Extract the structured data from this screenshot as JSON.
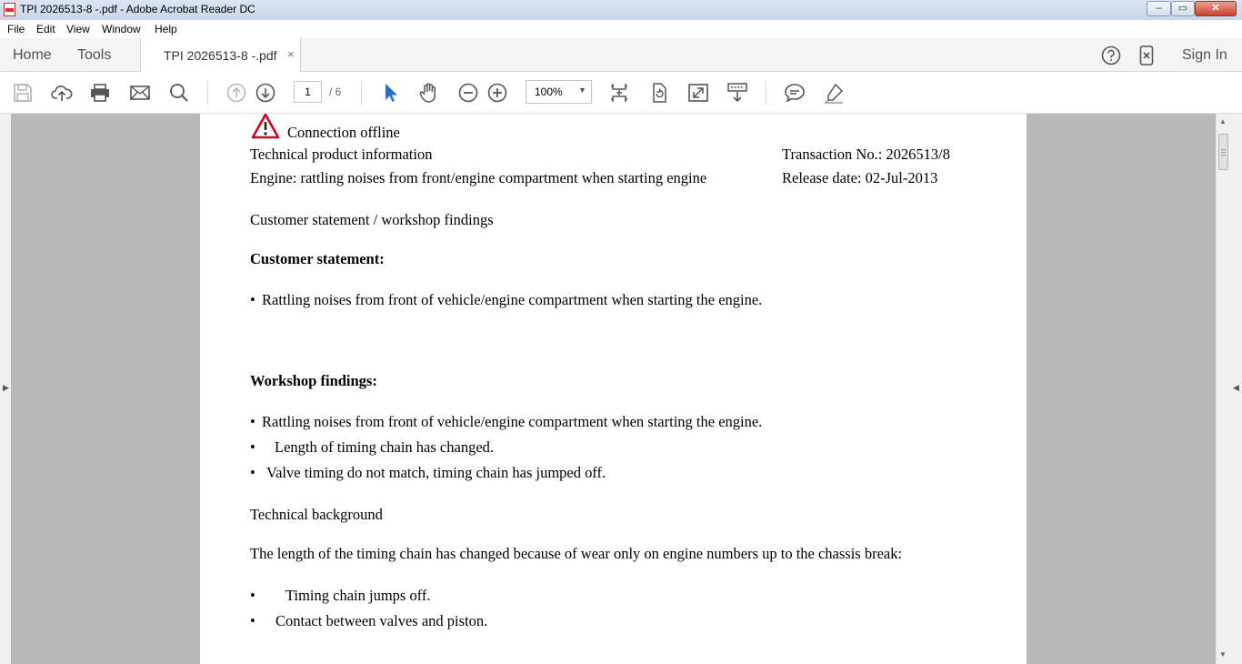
{
  "window": {
    "title": "TPI 2026513-8 -.pdf - Adobe Acrobat Reader DC",
    "minimize": "–",
    "maximize": "▭",
    "close": "✕"
  },
  "menu": [
    "File",
    "Edit",
    "View",
    "Window",
    "Help"
  ],
  "tabs": {
    "home": "Home",
    "tools": "Tools",
    "document": "TPI 2026513-8 -.pdf",
    "close": "×",
    "sign_in": "Sign In"
  },
  "toolbar": {
    "page_current": "1",
    "page_total": "/ 6",
    "zoom": "100%",
    "zoom_arrow": "▼"
  },
  "document": {
    "banner": "Connection offline",
    "header_left_1": "Technical product information",
    "header_right_1": "Transaction No.: 2026513/8",
    "header_left_2": "Engine: rattling noises from front/engine compartment when starting engine",
    "header_right_2": "Release date: 02-Jul-2013",
    "section_1": "Customer statement / workshop findings",
    "customer_heading": "Customer statement:",
    "customer_items": [
      "Rattling noises from front of vehicle/engine compartment when starting the engine."
    ],
    "workshop_heading": "Workshop findings:",
    "workshop_items": [
      "Rattling noises from front of vehicle/engine compartment when starting the engine.",
      "Length of timing chain has changed.",
      "Valve timing do not match, timing chain has jumped off."
    ],
    "section_2": "Technical background",
    "background_text": "The length of the timing chain has changed because of wear only on engine numbers up to the chassis break:",
    "background_items": [
      "Timing chain jumps off.",
      "Contact between valves and piston."
    ],
    "bullet": "•"
  },
  "icons": {
    "save": "save-icon",
    "upload": "cloud-upload-icon",
    "print": "print-icon",
    "email": "email-icon",
    "search": "search-icon",
    "prev": "page-up-icon",
    "next": "page-down-icon",
    "select": "select-cursor-icon",
    "hand": "hand-icon",
    "zoom_out": "zoom-out-icon",
    "zoom_in": "zoom-in-icon",
    "fit": "fit-page-icon",
    "rotate": "rotate-icon",
    "fullscreen": "fullscreen-icon",
    "scroll": "scroll-mode-icon",
    "comment": "comment-icon",
    "highlight": "highlight-icon",
    "help": "help-icon",
    "mobile": "mobile-link-icon",
    "warning": "warning-icon"
  },
  "colors": {
    "accent": "#2c6ecb",
    "warning": "#d0021b",
    "viewer_bg": "#b9b9b9"
  }
}
